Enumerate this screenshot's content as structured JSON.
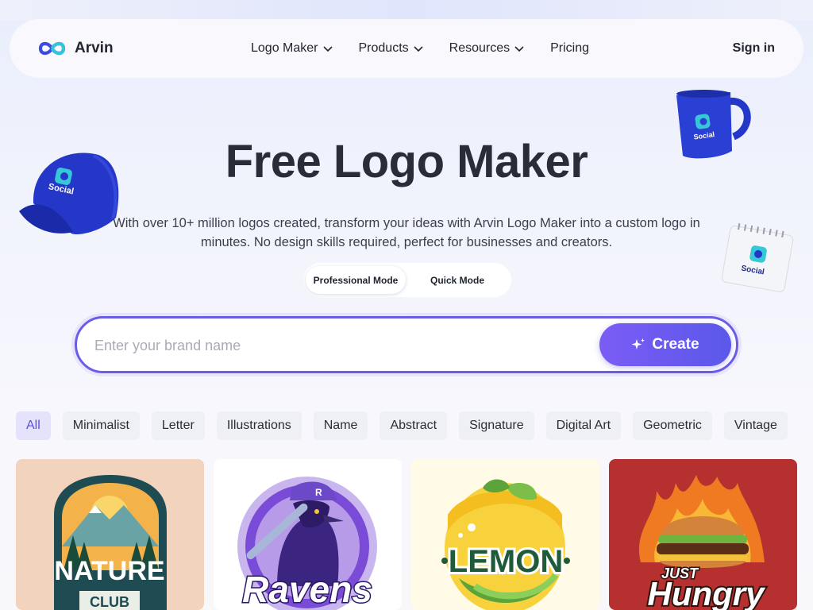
{
  "brand": {
    "name": "Arvin"
  },
  "nav": {
    "links": [
      {
        "label": "Logo Maker",
        "dropdown": true
      },
      {
        "label": "Products",
        "dropdown": true
      },
      {
        "label": "Resources",
        "dropdown": true
      },
      {
        "label": "Pricing",
        "dropdown": false
      }
    ],
    "signin": "Sign in"
  },
  "hero": {
    "title": "Free Logo Maker",
    "subtitle": "With over 10+ million logos created, transform your ideas with Arvin Logo Maker into a custom logo in minutes. No design skills required, perfect for businesses and creators.",
    "modes": {
      "active": "Professional Mode",
      "inactive": "Quick Mode"
    },
    "search": {
      "placeholder": "Enter your brand name",
      "value": ""
    },
    "create_label": "Create"
  },
  "categories": [
    "All",
    "Minimalist",
    "Letter",
    "Illustrations",
    "Name",
    "Abstract",
    "Signature",
    "Digital Art",
    "Geometric",
    "Vintage"
  ],
  "active_category": "All",
  "cards": [
    {
      "name": "nature-club",
      "line1": "NATURE",
      "line2": "CLUB",
      "bg": "#f2d3bd"
    },
    {
      "name": "ravens",
      "line1": "Ravens",
      "line2": "",
      "bg": "#ffffff"
    },
    {
      "name": "lemon",
      "line1": "LEMON",
      "line2": "",
      "bg": "#fffbe6"
    },
    {
      "name": "just-hungry",
      "line1": "JUST",
      "line2": "Hungry",
      "bg": "#b5302e"
    }
  ],
  "products": {
    "brand_text": "Social"
  },
  "colors": {
    "accent": "#6a5de6",
    "create_start": "#7b5cf5",
    "create_end": "#5b58ea",
    "merch_blue": "#2437c9"
  },
  "icons": {
    "brand": "infinity-logo-icon",
    "chevron": "chevron-down-icon",
    "sparkle": "sparkle-icon"
  }
}
